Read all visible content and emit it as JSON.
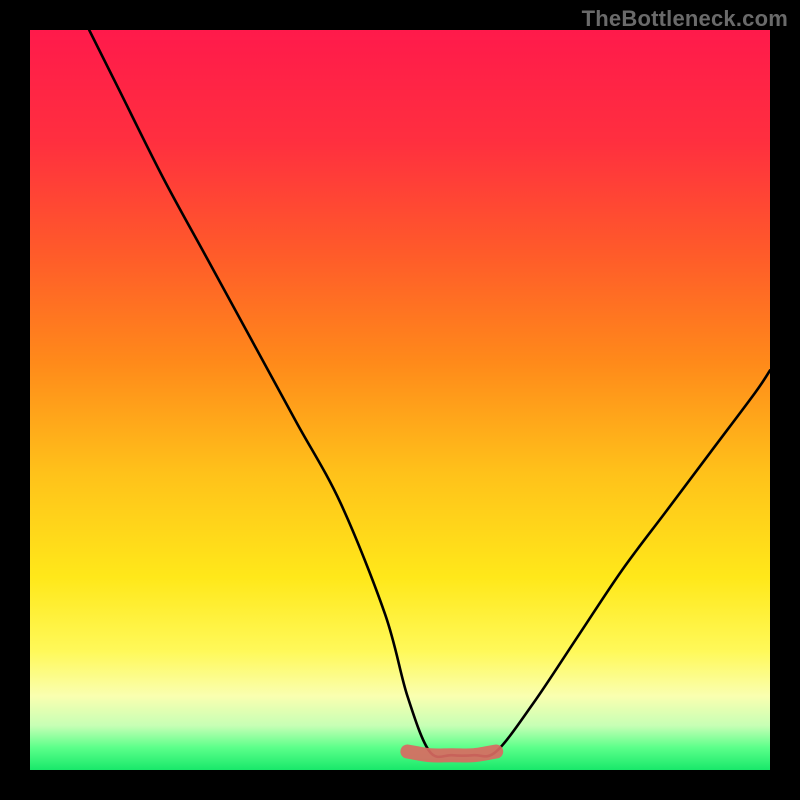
{
  "watermark": "TheBottleneck.com",
  "chart_data": {
    "type": "line",
    "title": "",
    "xlabel": "",
    "ylabel": "",
    "xlim": [
      0,
      100
    ],
    "ylim": [
      0,
      100
    ],
    "grid": false,
    "series": [
      {
        "name": "bottleneck-curve",
        "x": [
          8,
          12,
          18,
          24,
          30,
          36,
          42,
          48,
          51,
          54,
          57,
          60,
          63,
          68,
          74,
          80,
          86,
          92,
          98,
          100
        ],
        "y": [
          100,
          92,
          80,
          69,
          58,
          47,
          36,
          21,
          10,
          2.5,
          2,
          2,
          2.5,
          9,
          18,
          27,
          35,
          43,
          51,
          54
        ]
      },
      {
        "name": "bottom-highlight",
        "x": [
          51,
          54,
          57,
          60,
          63
        ],
        "y": [
          2.5,
          2,
          2,
          2,
          2.5
        ]
      }
    ],
    "gradient_stops": [
      {
        "offset": 0.0,
        "color": "#ff1a4b"
      },
      {
        "offset": 0.15,
        "color": "#ff2f3f"
      },
      {
        "offset": 0.3,
        "color": "#ff5a2a"
      },
      {
        "offset": 0.45,
        "color": "#ff8a1a"
      },
      {
        "offset": 0.6,
        "color": "#ffc21a"
      },
      {
        "offset": 0.74,
        "color": "#ffe81a"
      },
      {
        "offset": 0.84,
        "color": "#fff95a"
      },
      {
        "offset": 0.9,
        "color": "#faffb0"
      },
      {
        "offset": 0.94,
        "color": "#c7ffb5"
      },
      {
        "offset": 0.97,
        "color": "#5bff8a"
      },
      {
        "offset": 1.0,
        "color": "#18e86a"
      }
    ]
  }
}
